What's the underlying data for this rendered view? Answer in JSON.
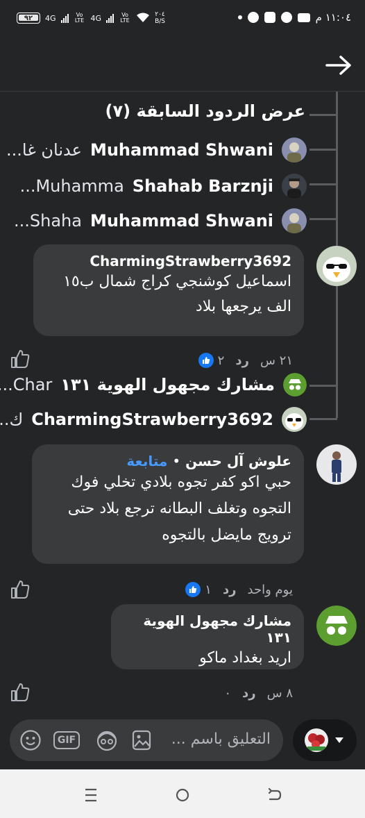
{
  "status_bar": {
    "time": "١١:٠٤ م",
    "battery": "٩٢",
    "speed_value": "٢٠٤",
    "speed_unit": "B/S",
    "net1": "4G",
    "net2": "4G",
    "volte": "Vo LTE",
    "icons": [
      "dot",
      "facebook-icon",
      "app-icon",
      "messenger-icon",
      "youtube-icon"
    ]
  },
  "header": {
    "back_icon": "arrow-right-icon"
  },
  "thread": {
    "previous_replies": "عرض الردود السابقة (٧)",
    "reply_previews": [
      {
        "name": "Muhammad Shwani",
        "snippet": "عدنان غا..."
      },
      {
        "name": "Shahab Barznji",
        "snippet": "Muhamma..."
      },
      {
        "name": "Muhammad Shwani",
        "snippet": "Shaha..."
      }
    ],
    "comments": [
      {
        "author": "CharmingStrawberry3692",
        "text": "اسماعيل كوشنجي كراج شمال ب١٥ الف يرجعها بلاد",
        "time": "٢١ س",
        "reply_label": "رد",
        "likes": "٢",
        "replies": [
          {
            "name": "مشارك مجهول الهوية ١٣١",
            "snippet": "Char..."
          },
          {
            "name": "CharmingStrawberry3692",
            "snippet": "ك..."
          }
        ]
      },
      {
        "author": "علوش آل حسن",
        "follow_label": "متابعة",
        "separator": "•",
        "text": "حبي اكو كفر تجوه بلادي تخلي فوك التجوه وتغلف البطانه ترجع بلاد حتى ترويج مايضل بالتجوه",
        "time": "يوم واحد",
        "reply_label": "رد",
        "likes": "١"
      },
      {
        "author": "مشارك مجهول الهوية ١٣١",
        "text": "اريد بغداد ماكو",
        "time": "٨ س",
        "reply_label": "رد",
        "likes": "٠"
      }
    ]
  },
  "composer": {
    "placeholder": "التعليق باسم ...",
    "gif_label": "GIF",
    "icons": [
      "emoji-icon",
      "gif-icon",
      "avatar-sticker-icon",
      "image-icon"
    ]
  },
  "colors": {
    "background": "#242527",
    "bubble": "#3a3b3c",
    "accent": "#4599ff",
    "like_blue": "#1877f2",
    "anon_green": "#5d9e30"
  },
  "nav_bar": {
    "icons": [
      "recent-apps-icon",
      "home-icon",
      "back-icon"
    ]
  }
}
